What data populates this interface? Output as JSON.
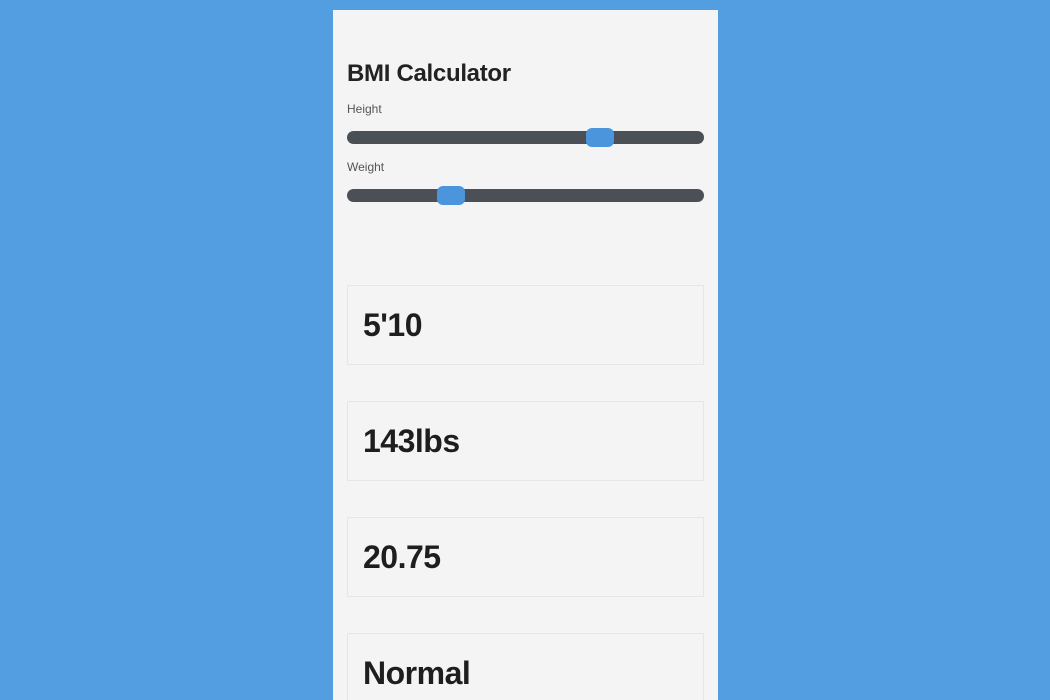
{
  "app": {
    "title": "BMI Calculator"
  },
  "sliders": {
    "height": {
      "label": "Height",
      "fraction": 0.71
    },
    "weight": {
      "label": "Weight",
      "fraction": 0.29
    }
  },
  "results": {
    "height_display": "5'10",
    "weight_display": "143lbs",
    "bmi_value": "20.75",
    "category": "Normal"
  },
  "colors": {
    "background": "#529ee0",
    "card": "#f4f4f4",
    "track": "#4b4f56",
    "thumb": "#4a95dc"
  }
}
